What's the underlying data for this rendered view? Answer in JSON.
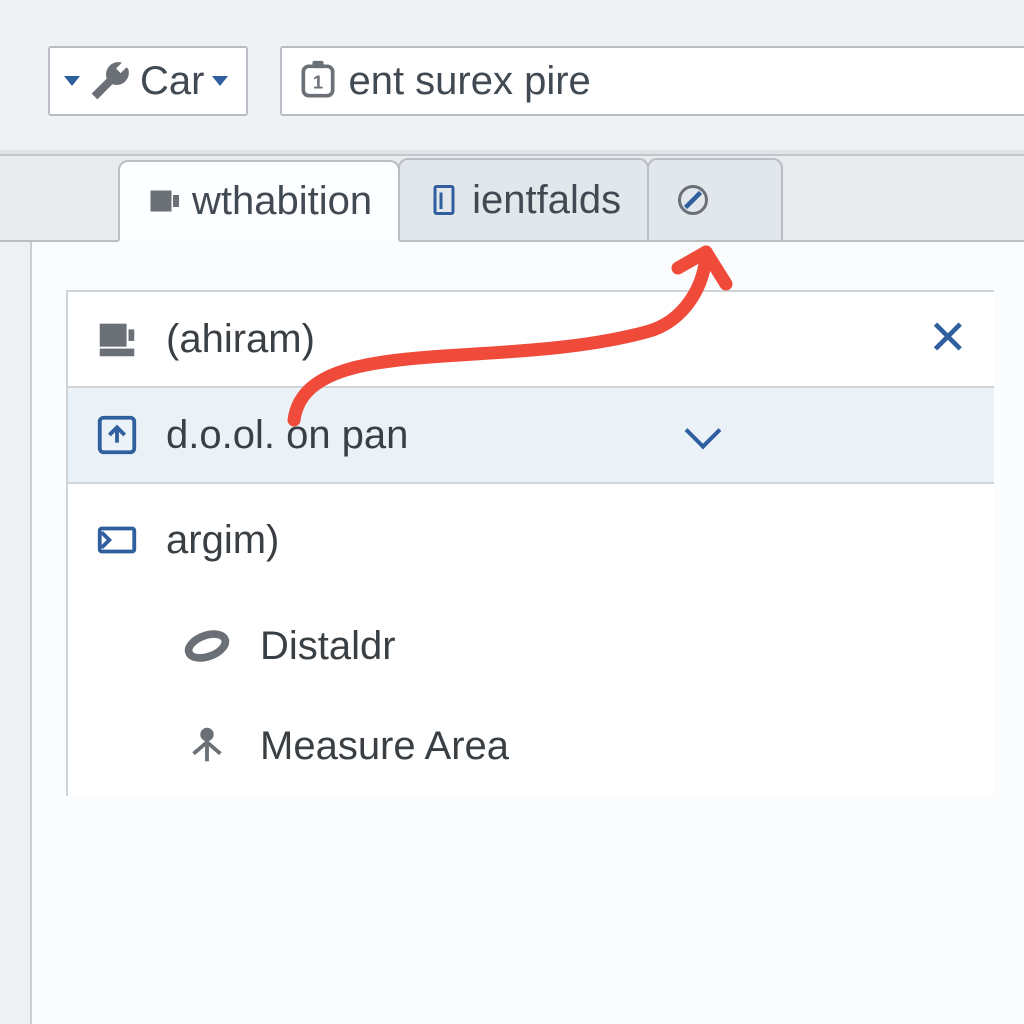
{
  "toolbar": {
    "tools_label": "Car",
    "status_label": "ent surex pire"
  },
  "tabs": {
    "items": [
      {
        "label": "wthabition",
        "active": true
      },
      {
        "label": "ientfalds",
        "active": false
      },
      {
        "label": "",
        "active": false
      }
    ]
  },
  "panel": {
    "search_value": "(ahiram)",
    "dropdown_value": "d.o.ol. on pan",
    "group_label": "argim)",
    "items": [
      "Distaldr",
      "Measure Area"
    ]
  }
}
